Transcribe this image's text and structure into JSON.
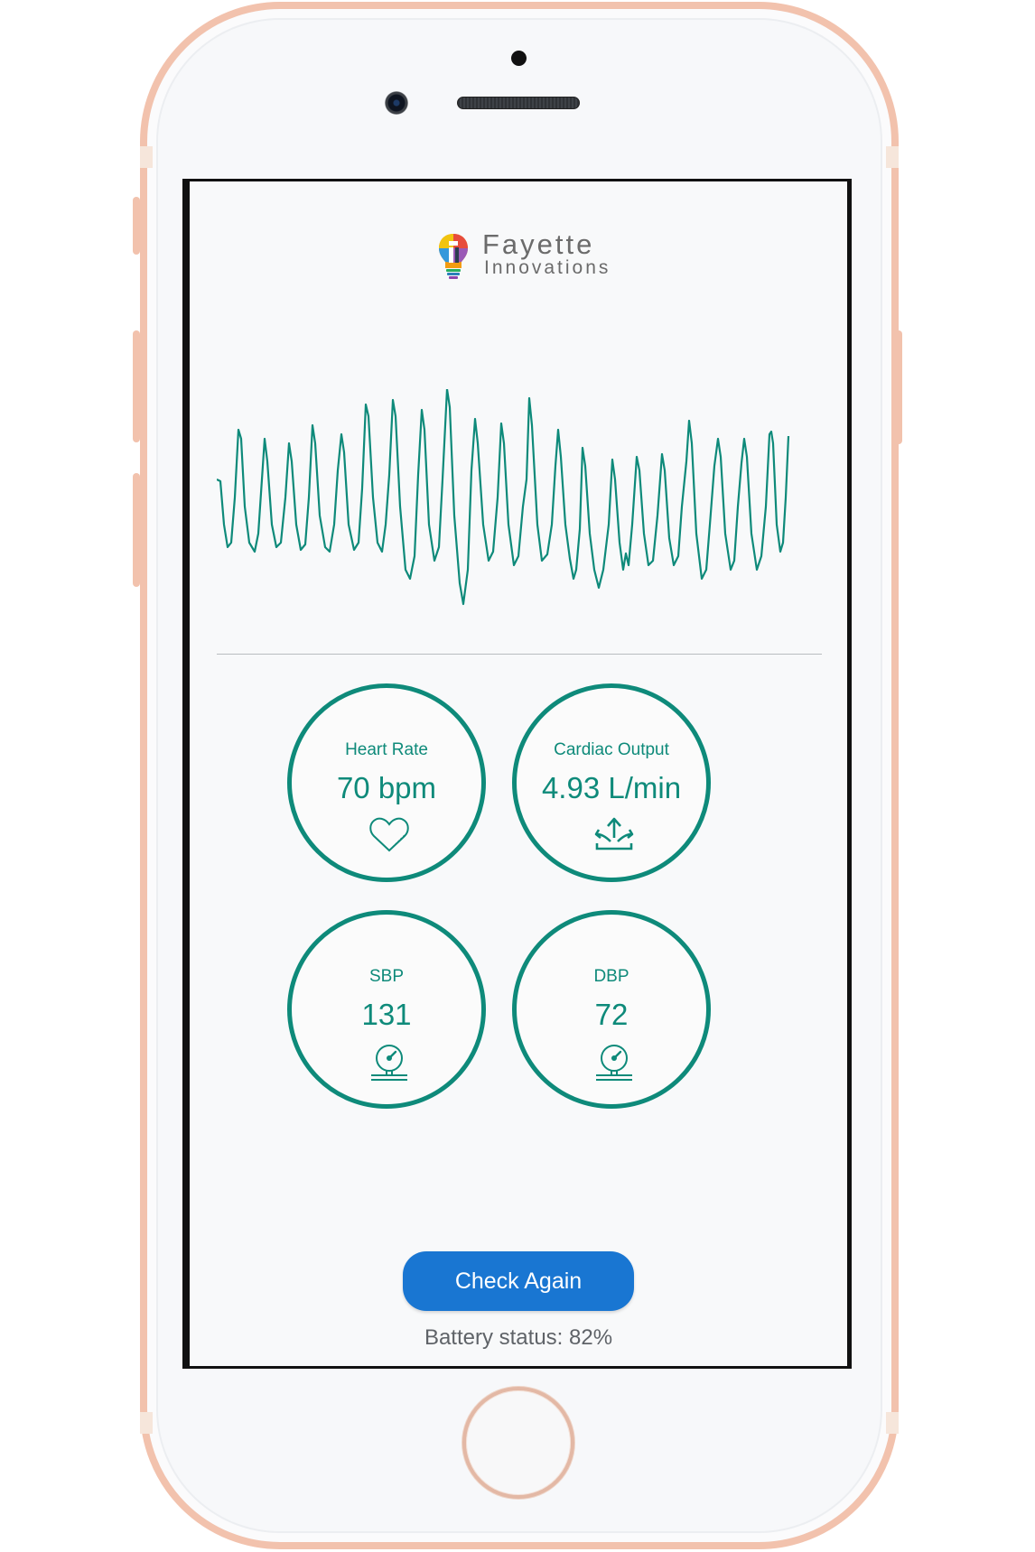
{
  "brand": {
    "name": "Fayette",
    "tagline": "Innovations"
  },
  "waveform": {
    "icon": "ppg-waveform",
    "color": "#0e8a7a"
  },
  "metrics": {
    "heart_rate": {
      "label": "Heart Rate",
      "value": "70 bpm",
      "icon": "heart-icon"
    },
    "cardiac_output": {
      "label": "Cardiac Output",
      "value": "4.93 L/min",
      "icon": "cardiac-output-icon"
    },
    "sbp": {
      "label": "SBP",
      "value": "131",
      "icon": "pressure-gauge-icon"
    },
    "dbp": {
      "label": "DBP",
      "value": "72",
      "icon": "pressure-gauge-icon"
    }
  },
  "actions": {
    "check_again": "Check Again"
  },
  "status": {
    "battery": "Battery status: 82%"
  },
  "colors": {
    "accent": "#0e8a7a",
    "button": "#1976d2",
    "phone_frame": "#f2c2ad"
  }
}
